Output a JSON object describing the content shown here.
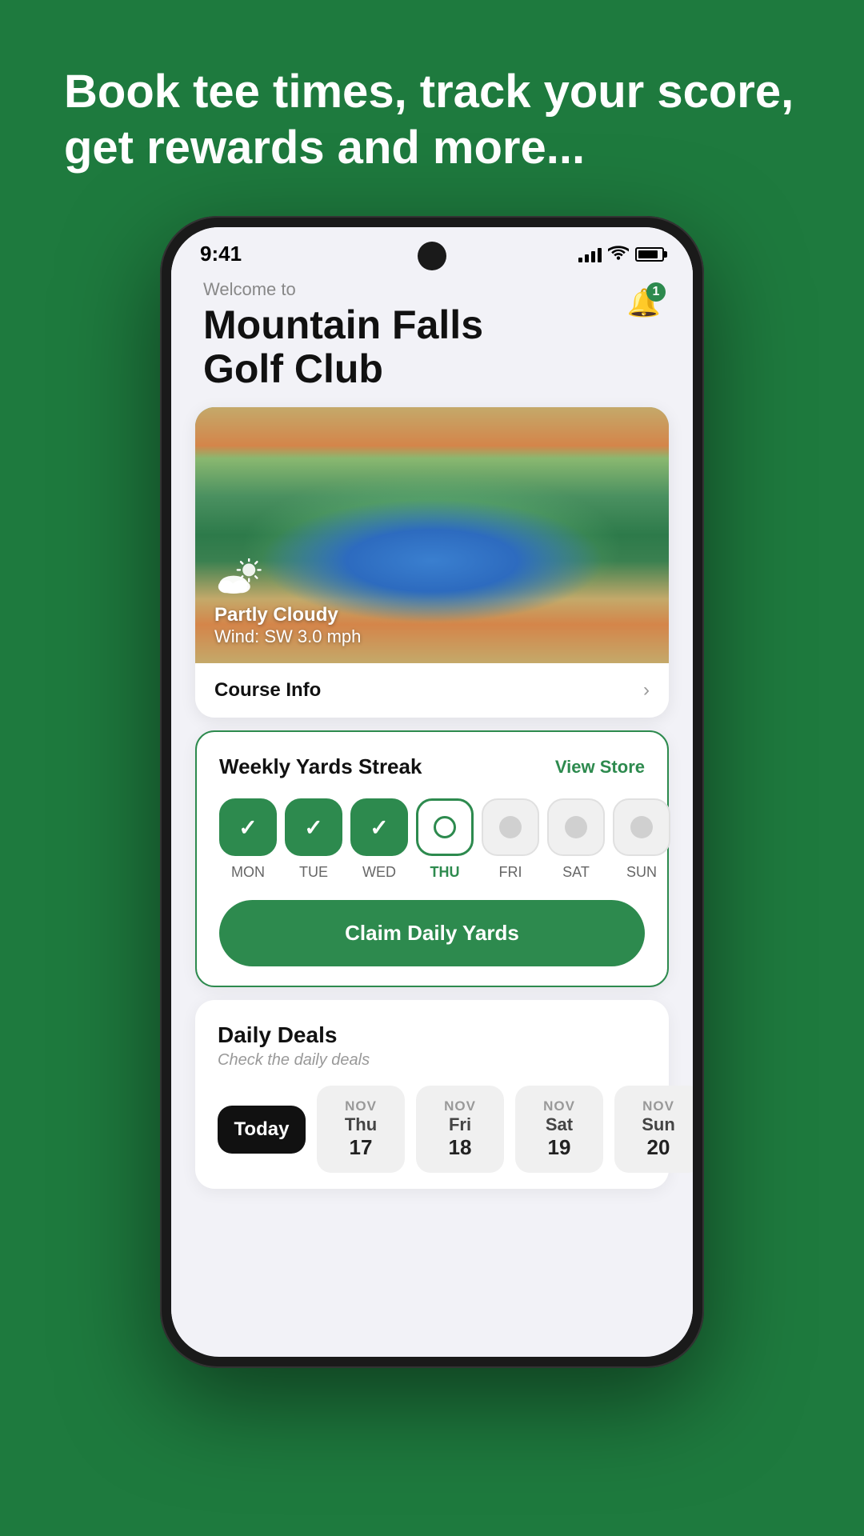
{
  "background": {
    "color": "#1e7a3e"
  },
  "tagline": "Book tee times, track your score, get rewards and more...",
  "phone": {
    "status_bar": {
      "time": "9:41",
      "signal_bars": 4,
      "battery_percent": 85
    },
    "header": {
      "welcome_text": "Welcome to",
      "club_name": "Mountain Falls\nGolf Club",
      "notification_count": "1"
    },
    "course_card": {
      "weather": {
        "condition": "Partly Cloudy",
        "wind": "Wind: SW 3.0 mph"
      },
      "course_info_label": "Course Info",
      "course_info_arrow": "›"
    },
    "streak_card": {
      "title": "Weekly Yards Streak",
      "view_store_label": "View Store",
      "days": [
        {
          "label": "MON",
          "state": "completed"
        },
        {
          "label": "TUE",
          "state": "completed"
        },
        {
          "label": "WED",
          "state": "completed"
        },
        {
          "label": "THU",
          "state": "today"
        },
        {
          "label": "FRI",
          "state": "future"
        },
        {
          "label": "SAT",
          "state": "future"
        },
        {
          "label": "SUN",
          "state": "future"
        }
      ],
      "claim_button_label": "Claim Daily Yards"
    },
    "daily_deals": {
      "title": "Daily Deals",
      "subtitle": "Check the daily deals",
      "dates": [
        {
          "label": "Today",
          "day_name": "Today",
          "month": "",
          "num": "",
          "state": "today"
        },
        {
          "label": "Thu 17",
          "day_name": "Thu",
          "month": "NOV",
          "num": "17",
          "state": "normal"
        },
        {
          "label": "Fri 18",
          "day_name": "Fri",
          "month": "NOV",
          "num": "18",
          "state": "normal"
        },
        {
          "label": "Sat 19",
          "day_name": "Sat",
          "month": "NOV",
          "num": "19",
          "state": "normal"
        },
        {
          "label": "Sun 20",
          "day_name": "Sun",
          "month": "NOV",
          "num": "20",
          "state": "normal"
        }
      ]
    }
  }
}
